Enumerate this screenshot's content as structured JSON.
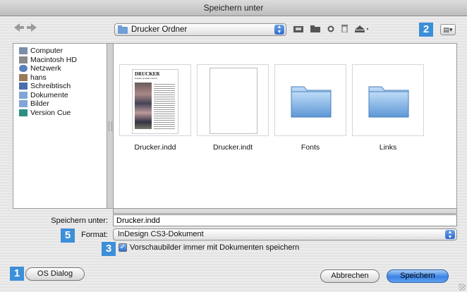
{
  "window": {
    "title": "Speichern unter"
  },
  "toolbar": {
    "location": "Drucker Ordner",
    "badge_view": "2"
  },
  "sidebar": {
    "items": [
      {
        "label": "Computer",
        "icon": "computer-icon",
        "color": "#7a8fa8"
      },
      {
        "label": "Macintosh HD",
        "icon": "harddisk-icon",
        "color": "#8a8a8a"
      },
      {
        "label": "Netzwerk",
        "icon": "network-icon",
        "color": "#5a7fbf"
      },
      {
        "label": "hans",
        "icon": "home-icon",
        "color": "#9a7a5a"
      },
      {
        "label": "Schreibtisch",
        "icon": "desktop-icon",
        "color": "#4a6fae"
      },
      {
        "label": "Dokumente",
        "icon": "documents-folder-icon",
        "color": "#7fa6d6"
      },
      {
        "label": "Bilder",
        "icon": "pictures-folder-icon",
        "color": "#7fa6d6"
      },
      {
        "label": "Version Cue",
        "icon": "version-cue-icon",
        "color": "#2f8f7f"
      }
    ]
  },
  "files": [
    {
      "name": "Drucker.indd",
      "kind": "document-preview",
      "preview_title": "DRUCKER",
      "preview_subtitle": "Digitale Qualität Zukunft"
    },
    {
      "name": "Drucker.indt",
      "kind": "blank-template"
    },
    {
      "name": "Fonts",
      "kind": "folder"
    },
    {
      "name": "Links",
      "kind": "folder"
    }
  ],
  "form": {
    "save_as_label": "Speichern unter:",
    "save_as_value": "Drucker.indd",
    "format_badge": "5",
    "format_label": "Format:",
    "format_value": "InDesign CS3-Dokument",
    "preview_badge": "3",
    "preview_checkbox_label": "Vorschaubilder immer mit Dokumenten speichern",
    "preview_checked": true
  },
  "buttons": {
    "os_badge": "1",
    "os_dialog": "OS Dialog",
    "cancel": "Abbrechen",
    "save": "Speichern"
  },
  "colors": {
    "badge": "#3c8fd8",
    "primary_button": "#3a82e4"
  }
}
